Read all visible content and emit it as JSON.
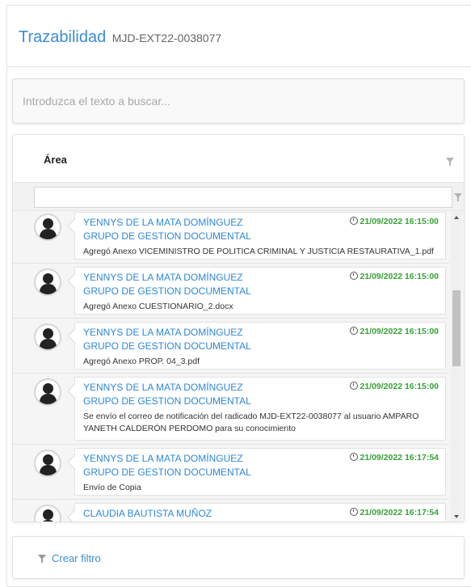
{
  "header": {
    "title": "Trazabilidad",
    "radicado": "MJD-EXT22-0038077"
  },
  "search": {
    "placeholder": "Introduzca el texto a buscar..."
  },
  "grid": {
    "column_title": "Área",
    "entries": [
      {
        "name": "YENNYS DE LA MATA DOMÍNGUEZ",
        "group": "GRUPO DE GESTION DOCUMENTAL",
        "description": "Agregó Anexo VICEMINISTRO DE POLITICA CRIMINAL Y JUSTICIA RESTAURATIVA_1.pdf",
        "timestamp": "21/09/2022 16:15:00"
      },
      {
        "name": "YENNYS DE LA MATA DOMÍNGUEZ",
        "group": "GRUPO DE GESTION DOCUMENTAL",
        "description": "Agregó Anexo CUESTIONARIO_2.docx",
        "timestamp": "21/09/2022 16:15:00"
      },
      {
        "name": "YENNYS DE LA MATA DOMÍNGUEZ",
        "group": "GRUPO DE GESTION DOCUMENTAL",
        "description": "Agregó Anexo PROP. 04_3.pdf",
        "timestamp": "21/09/2022 16:15:00"
      },
      {
        "name": "YENNYS DE LA MATA DOMÍNGUEZ",
        "group": "GRUPO DE GESTION DOCUMENTAL",
        "description": "Se envío el correo de notificación del radicado MJD-EXT22-0038077 al usuario AMPARO YANETH CALDERÓN PERDOMO para su conocimiento",
        "timestamp": "21/09/2022 16:15:00"
      },
      {
        "name": "YENNYS DE LA MATA DOMÍNGUEZ",
        "group": "GRUPO DE GESTION DOCUMENTAL",
        "description": "Envío de Copia",
        "timestamp": "21/09/2022 16:17:54"
      },
      {
        "name": "CLAUDIA BAUTISTA MUÑOZ",
        "group": "",
        "description": "",
        "timestamp": "21/09/2022 16:17:54"
      }
    ]
  },
  "footer": {
    "create_filter_label": "Crear filtro"
  },
  "colors": {
    "accent": "#3a8dd6",
    "timestamp": "#36a336"
  },
  "icons": {
    "filter": "filter-icon",
    "avatar": "user-avatar-icon",
    "clock": "clock-icon"
  }
}
